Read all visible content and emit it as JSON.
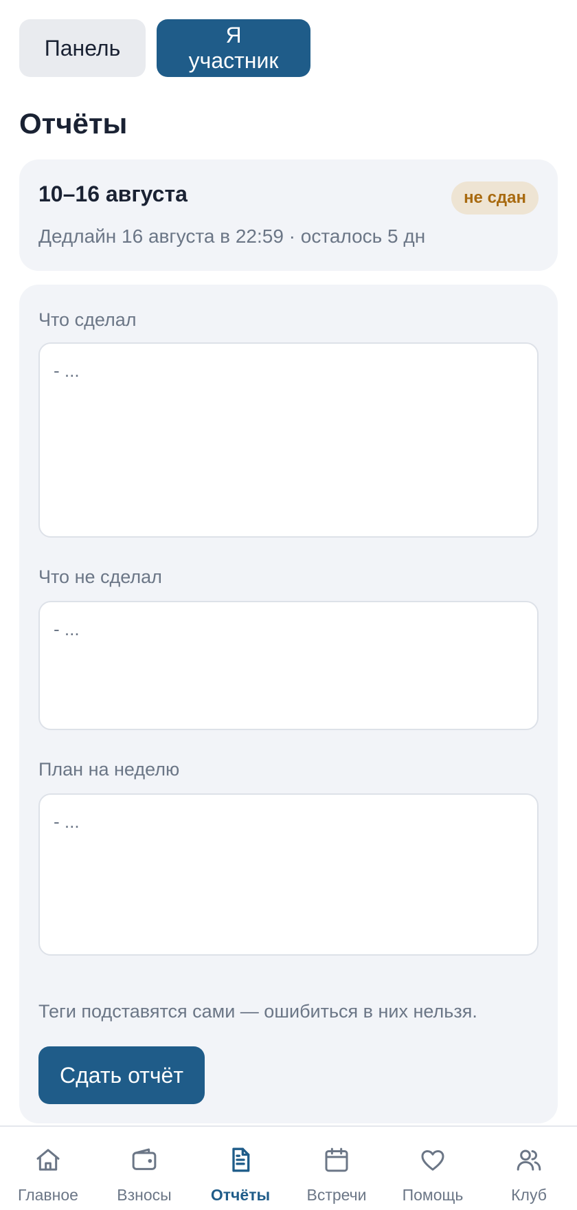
{
  "role_switch": {
    "panel_label": "Панель",
    "member_label": "Я участник"
  },
  "page_title": "Отчёты",
  "week": {
    "title": "10–16 августа",
    "status": "не сдан",
    "deadline": "Дедлайн 16 августа в 22:59 · осталось 5 дн"
  },
  "form": {
    "done_label": "Что сделал",
    "done_placeholder": "- ...",
    "not_done_label": "Что не сделал",
    "not_done_placeholder": "- ...",
    "plan_label": "План на неделю",
    "plan_placeholder": "- ...",
    "hint": "Теги подставятся сами — ошибиться в них нельзя.",
    "submit_label": "Сдать отчёт"
  },
  "nav": {
    "items": [
      {
        "label": "Главное",
        "icon": "home-icon"
      },
      {
        "label": "Взносы",
        "icon": "wallet-icon"
      },
      {
        "label": "Отчёты",
        "icon": "document-icon"
      },
      {
        "label": "Встречи",
        "icon": "calendar-icon"
      },
      {
        "label": "Помощь",
        "icon": "heart-icon"
      },
      {
        "label": "Клуб",
        "icon": "users-icon"
      }
    ],
    "active_index": 2
  },
  "colors": {
    "accent": "#1f5c89",
    "badge_bg": "#eee4d3",
    "badge_text": "#a86a10",
    "card_bg": "#f2f4f8"
  }
}
